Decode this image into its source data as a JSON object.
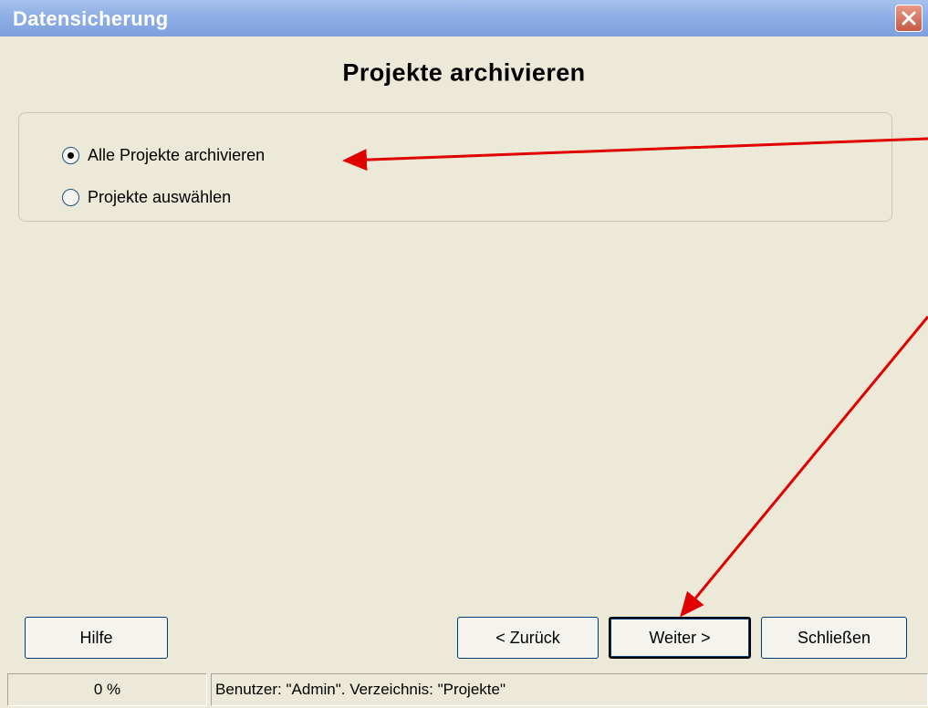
{
  "window": {
    "title": "Datensicherung"
  },
  "page": {
    "heading": "Projekte archivieren"
  },
  "options": [
    {
      "label": "Alle Projekte archivieren",
      "selected": true
    },
    {
      "label": "Projekte auswählen",
      "selected": false
    }
  ],
  "buttons": {
    "help": "Hilfe",
    "back": "< Zurück",
    "next": "Weiter >",
    "close": "Schließen"
  },
  "status": {
    "progress": "0 %",
    "info": "Benutzer: \"Admin\". Verzeichnis: \"Projekte\""
  },
  "colors": {
    "titlebar": "#8eaee5",
    "face": "#ece9d8",
    "annotation_arrows": "#e00000"
  }
}
